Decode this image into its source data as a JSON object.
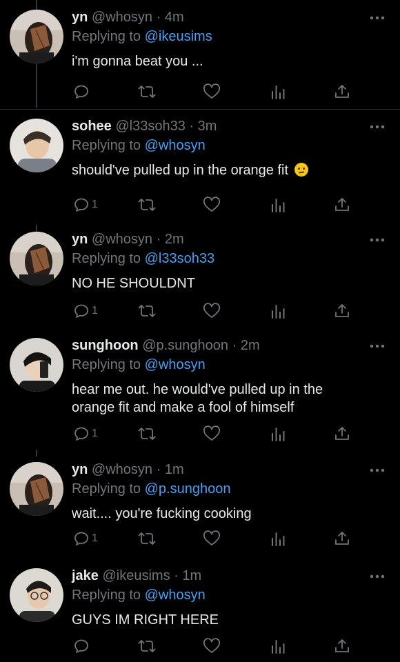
{
  "colors": {
    "background": "#000000",
    "text": "#e7e9ea",
    "muted": "#71767b",
    "link": "#4a9ff0"
  },
  "tweets": [
    {
      "name": "yn",
      "handle": "@whosyn",
      "sep": "·",
      "time": "4m",
      "replying_prefix": "Replying to",
      "replying_to": "@ikeusims",
      "text": "i'm gonna beat you ...",
      "reply_count": "",
      "avatar": "avatar-yn"
    },
    {
      "name": "sohee",
      "handle": "@l33soh33",
      "sep": "·",
      "time": "3m",
      "replying_prefix": "Replying to",
      "replying_to": "@whosyn",
      "text": "should've pulled up in the orange fit",
      "emoji": "confused-face-emoji",
      "reply_count": "1",
      "avatar": "avatar-sohee"
    },
    {
      "name": "yn",
      "handle": "@whosyn",
      "sep": "·",
      "time": "2m",
      "replying_prefix": "Replying to",
      "replying_to": "@l33soh33",
      "text": "NO HE SHOULDNT",
      "reply_count": "1",
      "avatar": "avatar-yn"
    },
    {
      "name": "sunghoon",
      "handle": "@p.sunghoon",
      "sep": "·",
      "time": "2m",
      "replying_prefix": "Replying to",
      "replying_to": "@whosyn",
      "text_line1": "hear me out. he would've pulled up in the",
      "text_line2": "orange fit and make a fool of himself",
      "reply_count": "1",
      "avatar": "avatar-sunghoon"
    },
    {
      "name": "yn",
      "handle": "@whosyn",
      "sep": "·",
      "time": "1m",
      "replying_prefix": "Replying to",
      "replying_to": "@p.sunghoon",
      "text": "wait.... you're fucking cooking",
      "reply_count": "1",
      "avatar": "avatar-yn"
    },
    {
      "name": "jake",
      "handle": "@ikeusims",
      "sep": "·",
      "time": "1m",
      "replying_prefix": "Replying to",
      "replying_to": "@whosyn",
      "text": "GUYS IM RIGHT HERE",
      "reply_count": "",
      "avatar": "avatar-jake"
    }
  ]
}
